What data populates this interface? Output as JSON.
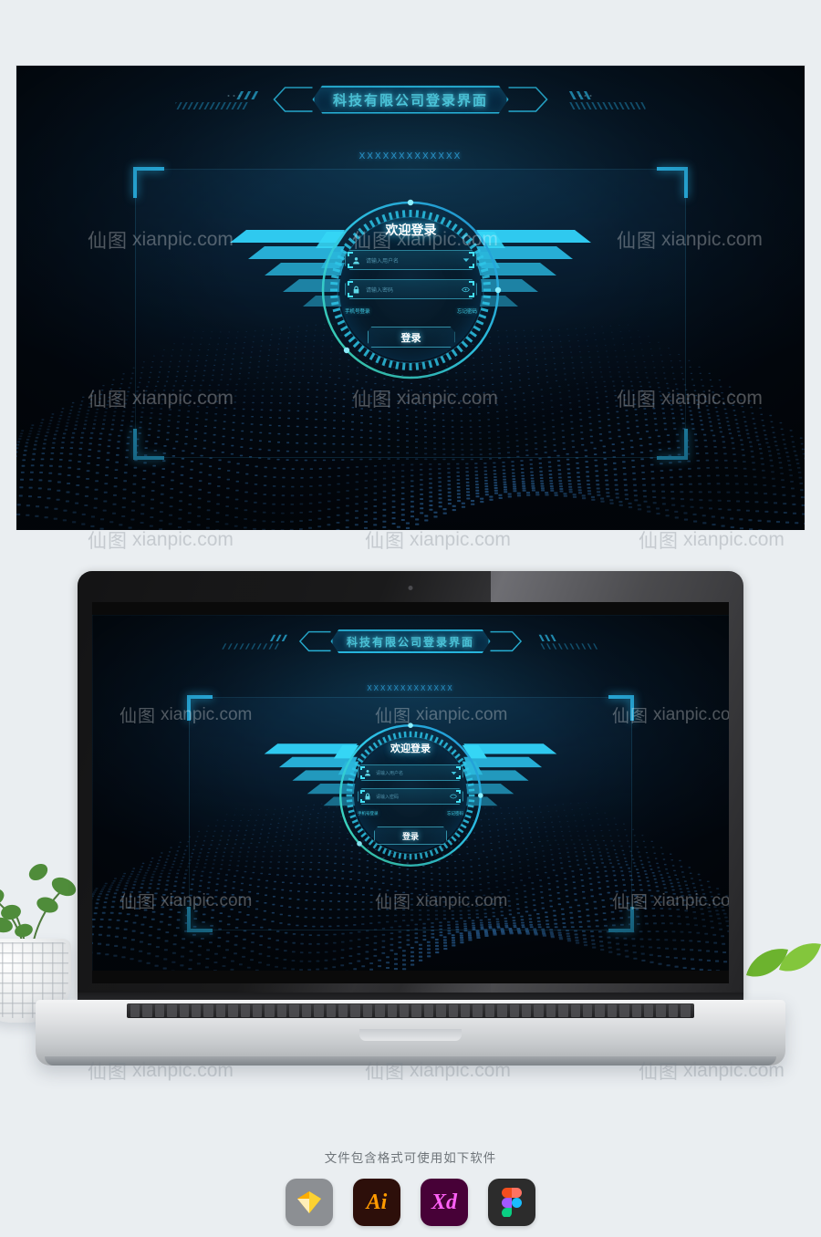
{
  "page": {
    "background_color": "#eaeef1"
  },
  "screen": {
    "title_banner": {
      "text": "科技有限公司登录界面"
    },
    "masked_label": "XXXXXXXXXXXXX",
    "login": {
      "heading": "欢迎登录",
      "username": {
        "placeholder": "请输入用户名",
        "icon": "user-icon",
        "trailing_icon": "chevron-down-icon"
      },
      "password": {
        "placeholder": "请输入密码",
        "icon": "lock-icon",
        "trailing_icon": "eye-icon"
      },
      "phone_login_link": "手机号登录",
      "forgot_password_link": "忘记密码",
      "submit_label": "登录"
    },
    "colors": {
      "accent_cyan": "#2ec6ff",
      "accent_teal": "#44e0f5",
      "ring_green": "#3fd6a8",
      "text_white": "#ffffff",
      "panel_dark": "#061724",
      "link_cyan": "#3ec7e0"
    }
  },
  "watermark": {
    "cn": "仙图",
    "domain": "xianpic.com"
  },
  "footer": {
    "note": "文件包含格式可使用如下软件",
    "apps": [
      {
        "name": "sketch-icon",
        "label": ""
      },
      {
        "name": "illustrator-icon",
        "label": "Ai"
      },
      {
        "name": "xd-icon",
        "label": "Xd"
      },
      {
        "name": "figma-icon",
        "label": ""
      }
    ]
  }
}
